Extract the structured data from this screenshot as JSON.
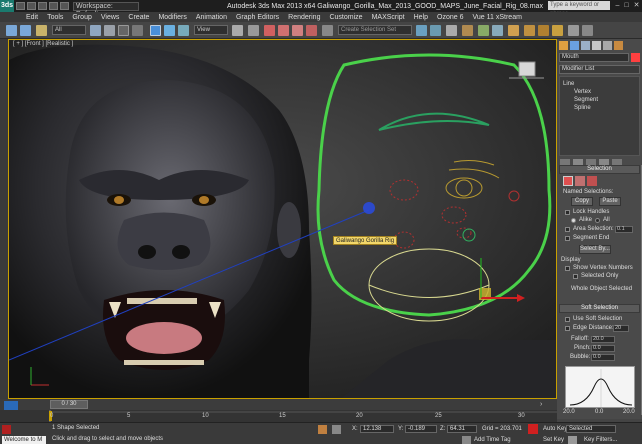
{
  "title_bar": {
    "logo": "3ds",
    "workspace": "Workspace: Default",
    "window_title": "Autodesk 3ds Max 2013 x64     Galiwango_Gorilla_Max_2013_GOOD_MAPS_June_Facial_Rig_08.max",
    "search_placeholder": "Type a keyword or phrase"
  },
  "menu": [
    "Edit",
    "Tools",
    "Group",
    "Views",
    "Create",
    "Modifiers",
    "Animation",
    "Graph Editors",
    "Rendering",
    "Customize",
    "MAXScript",
    "Help",
    "Ozone 6",
    "Vue 11 xStream"
  ],
  "toolbar": {
    "selection_filter": "All",
    "ref_coord": "View",
    "named_selection_placeholder": "Create Selection Set"
  },
  "viewport": {
    "label": "[ + ] [Front ] [Realistic ]",
    "tooltip": "Galiwango Gorilla Rig",
    "accent": "#c8a000",
    "rig_outline_color": "#4ad14a"
  },
  "command_panel": {
    "object_name": "Mouth",
    "modifier_list": "Modifier List",
    "stack": [
      "Line",
      "Vertex",
      "Segment",
      "Spline"
    ],
    "selection": {
      "header": "Selection",
      "named_selections": "Named Selections:",
      "copy": "Copy",
      "paste": "Paste",
      "lock_handles": "Lock Handles",
      "alike": "Alike",
      "all": "All",
      "area_selection": "Area Selection:",
      "area_value": "0.1",
      "segment_end": "Segment End",
      "select_by": "Select By...",
      "display": "Display",
      "show_vertex_numbers": "Show Vertex Numbers",
      "selected_only": "Selected Only",
      "whole_object_selected": "Whole Object Selected"
    },
    "soft_selection": {
      "header": "Soft Selection",
      "use_soft_selection": "Use Soft Selection",
      "edge_distance": "Edge Distance:",
      "edge_value": "20",
      "falloff": "Falloff:",
      "falloff_value": "20.0",
      "pinch": "Pinch:",
      "pinch_value": "0.0",
      "bubble": "Bubble:",
      "bubble_value": "0.0",
      "curve_left": "20.0",
      "curve_mid": "0.0",
      "curve_right": "20.0"
    }
  },
  "timeline": {
    "slider": "0 / 30",
    "ticks": [
      "0",
      "5",
      "10",
      "15",
      "20",
      "25",
      "30"
    ]
  },
  "status": {
    "listener": "Welcome to M",
    "shapes": "1 Shape Selected",
    "prompt": "Click and drag to select and move objects",
    "x_label": "X:",
    "x_value": "12.138",
    "y_label": "Y:",
    "y_value": "-0.189",
    "z_label": "Z:",
    "z_value": "64.31",
    "grid": "Grid = 203.701",
    "add_time_tag": "Add Time Tag",
    "auto_key": "Auto Key",
    "selected": "Selected",
    "set_key": "Set Key",
    "key_filters": "Key Filters..."
  }
}
